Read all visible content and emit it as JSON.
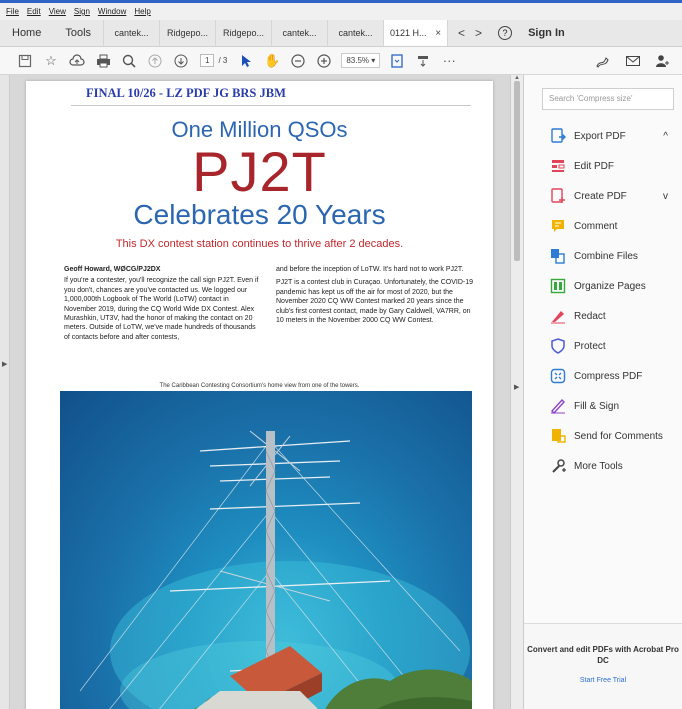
{
  "menu": [
    "File",
    "Edit",
    "View",
    "Sign",
    "Window",
    "Help"
  ],
  "tabbar": {
    "home": "Home",
    "tools": "Tools",
    "tabs": [
      "cantek...",
      "Ridgepo...",
      "Ridgepo...",
      "cantek...",
      "cantek..."
    ],
    "active_tab": "0121 H...",
    "close": "×",
    "back": "<",
    "forward": ">",
    "help": "?",
    "sign_in": "Sign In"
  },
  "toolbar": {
    "page_current": "1",
    "page_total": "/ 3",
    "zoom": "83.5%"
  },
  "document": {
    "final_line": "FINAL 10/26 - LZ  PDF  JG  BRS  JBM",
    "headline_1": "One Million QSOs",
    "headline_2": "PJ2T",
    "headline_3": "Celebrates 20 Years",
    "deck": "This DX contest station continues to thrive after 2 decades.",
    "byline": "Geoff Howard, WØCG/PJ2DX",
    "col1_p1": "If you're a contester, you'll recognize the call sign PJ2T. Even if you don't, chances are you've contacted us. We logged our 1,000,000th Logbook of The World (LoTW) contact in November 2019, during the CQ World Wide DX Contest. Alex Murashkin, UT3V, had the honor of making the contact on 20 meters. Outside of LoTW, we've made hundreds of thousands of contacts before and after contests,",
    "col2_p1": "and before the inception of LoTW. It's hard not to work PJ2T.",
    "col2_p2": "PJ2T is a contest club in Curaçao. Unfortunately, the COVID-19 pandemic has kept us off the air for most of 2020, but the November 2020 CQ WW Contest marked 20 years since the club's first contest contact, made by Gary Caldwell, VA7RR, on 10 meters in the November 2000 CQ WW Contest.",
    "caption": "The Caribbean Contesting Consortium's home view from one of the towers."
  },
  "right_panel": {
    "search_placeholder": "Search 'Compress size'",
    "tools": [
      {
        "label": "Export PDF",
        "icon": "export-pdf-icon",
        "color": "#2d7bd4",
        "chevron": "^"
      },
      {
        "label": "Edit PDF",
        "icon": "edit-pdf-icon",
        "color": "#e2445c",
        "chevron": ""
      },
      {
        "label": "Create PDF",
        "icon": "create-pdf-icon",
        "color": "#e2445c",
        "chevron": "v"
      },
      {
        "label": "Comment",
        "icon": "comment-icon",
        "color": "#f0b400",
        "chevron": ""
      },
      {
        "label": "Combine Files",
        "icon": "combine-files-icon",
        "color": "#2d7bd4",
        "chevron": ""
      },
      {
        "label": "Organize Pages",
        "icon": "organize-pages-icon",
        "color": "#35a83a",
        "chevron": ""
      },
      {
        "label": "Redact",
        "icon": "redact-icon",
        "color": "#e2445c",
        "chevron": ""
      },
      {
        "label": "Protect",
        "icon": "protect-icon",
        "color": "#4b5bd6",
        "chevron": ""
      },
      {
        "label": "Compress PDF",
        "icon": "compress-pdf-icon",
        "color": "#2d7bd4",
        "chevron": ""
      },
      {
        "label": "Fill & Sign",
        "icon": "fill-sign-icon",
        "color": "#8e44c9",
        "chevron": ""
      },
      {
        "label": "Send for Comments",
        "icon": "send-for-comments-icon",
        "color": "#f0b400",
        "chevron": ""
      },
      {
        "label": "More Tools",
        "icon": "more-tools-icon",
        "color": "#444444",
        "chevron": ""
      }
    ],
    "promo_title": "Convert and edit PDFs with Acrobat Pro DC",
    "promo_link": "Start Free Trial"
  }
}
